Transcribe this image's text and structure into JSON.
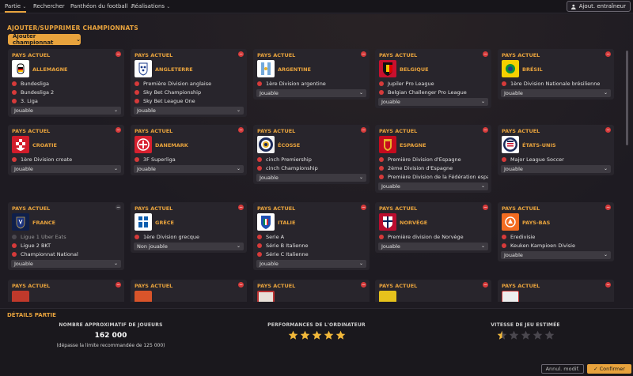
{
  "topbar": {
    "menu": [
      "Partie",
      "Rechercher",
      "Panthéon du football",
      "Réalisations"
    ],
    "add_trainer": "Ajout. entraîneur"
  },
  "section_title": "AJOUTER/SUPPRIMER CHAMPIONNATS",
  "add_league": "Ajouter championnat",
  "current_country": "PAYS ACTUEL",
  "cards": [
    {
      "country": "ALLEMAGNE",
      "leagues": [
        "Bundesliga",
        "Bundesliga 2",
        "3. Liga"
      ],
      "status": "Jouable"
    },
    {
      "country": "ANGLETERRE",
      "leagues": [
        "Première Division anglaise",
        "Sky Bet Championship",
        "Sky Bet League One"
      ],
      "status": "Jouable"
    },
    {
      "country": "ARGENTINE",
      "leagues": [
        "1ère Division argentine"
      ],
      "status": "Jouable"
    },
    {
      "country": "BELGIQUE",
      "leagues": [
        "Jupiler Pro League",
        "Belgian Challenger Pro League"
      ],
      "status": "Jouable"
    },
    {
      "country": "BRÉSIL",
      "leagues": [
        "1ère Division Nationale brésilienne"
      ],
      "status": "Jouable"
    },
    {
      "country": "CROATIE",
      "leagues": [
        "1ère Division croate"
      ],
      "status": "Jouable"
    },
    {
      "country": "DANEMARK",
      "leagues": [
        "3F Superliga"
      ],
      "status": "Jouable"
    },
    {
      "country": "ÉCOSSE",
      "leagues": [
        "cinch Premiership",
        "cinch Championship"
      ],
      "status": "Jouable"
    },
    {
      "country": "ESPAGNE",
      "leagues": [
        "Première Division d'Espagne",
        "2ème Division d'Espagne",
        "Première Division de la Fédération espag..."
      ],
      "status": "Jouable"
    },
    {
      "country": "ÉTATS-UNIS",
      "leagues": [
        "Major League Soccer"
      ],
      "status": "Jouable"
    },
    {
      "country": "FRANCE",
      "leagues": [
        "Ligue 1 Uber Eats",
        "Ligue 2 BKT",
        "Championnat National"
      ],
      "status": "Jouable"
    },
    {
      "country": "GRÈCE",
      "leagues": [
        "1ère Division grecque"
      ],
      "status": "Non jouable"
    },
    {
      "country": "ITALIE",
      "leagues": [
        "Serie A",
        "Série B Italienne",
        "Série C Italienne"
      ],
      "status": "Jouable"
    },
    {
      "country": "NORVÈGE",
      "leagues": [
        "Première division de Norvège"
      ],
      "status": "Jouable"
    },
    {
      "country": "PAYS-BAS",
      "leagues": [
        "Eredivisie",
        "Keuken Kampioen Divisie"
      ],
      "status": "Jouable"
    }
  ],
  "details": {
    "title": "DÉTAILS PARTIE",
    "players_label": "NOMBRE APPROXIMATIF DE JOUEURS",
    "players_value": "162 000",
    "players_note": "(dépasse la limite recommandée de 125 000)",
    "cpu_label": "PERFORMANCES DE L'ORDINATEUR",
    "cpu_stars": 5,
    "speed_label": "VITESSE DE JEU ESTIMÉE",
    "speed_stars": 0.5
  },
  "buttons": {
    "cancel": "Annul. modif.",
    "confirm": "Confirmer"
  },
  "colors": {
    "accent": "#e8a33d",
    "remove": "#d63a3a",
    "card": "#28252c"
  }
}
